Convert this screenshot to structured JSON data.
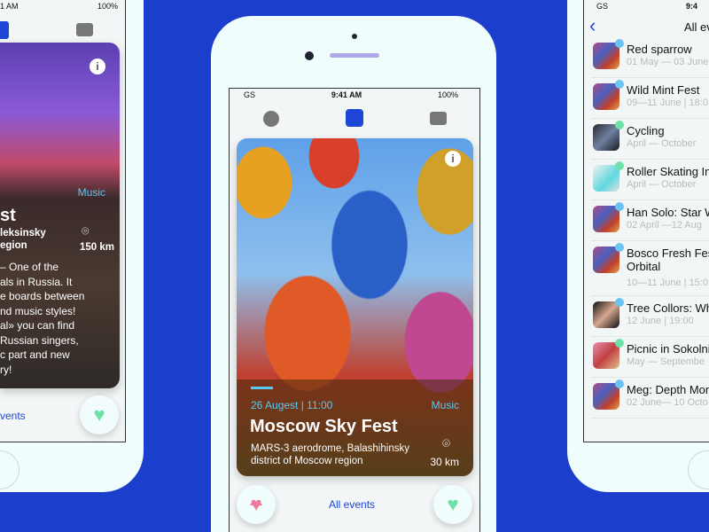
{
  "colors": {
    "background": "#1b3fcc",
    "accent": "#1d45d6",
    "highlight": "#5bc8f0",
    "like": "#6ee0a8",
    "dislike": "#f07a9a"
  },
  "left_phone": {
    "status": {
      "time": "1 AM",
      "battery": "100%"
    },
    "card": {
      "category": "Music",
      "title": "st",
      "location": "leksinsky\negion",
      "distance": "150 km",
      "description": [
        "– One of the",
        "als in Russia. It",
        "e boards between",
        "nd music styles!",
        "al» you can find",
        "Russian singers,",
        "c part and new",
        "ry!"
      ]
    },
    "all_events": "vents"
  },
  "center_phone": {
    "status": {
      "carrier": "GS",
      "time": "9:41 AM",
      "battery": "100%"
    },
    "nav": {
      "icons": [
        "profile-icon",
        "events-grid-icon",
        "chat-icon"
      ]
    },
    "card": {
      "date": "26 Augest | 11:00",
      "category": "Music",
      "title": "Moscow Sky Fest",
      "location_line1": "MARS-3 aerodrome, Balashihinsky",
      "location_line2": "district of Moscow region",
      "distance": "30 km"
    },
    "all_events": "All events"
  },
  "right_phone": {
    "status": {
      "carrier": "GS",
      "time": "9:4"
    },
    "title": "All eve",
    "items": [
      {
        "title": "Red sparrow",
        "sub": "01 May — 03 June",
        "dot": "#6cc4f2",
        "thumb": "crowd"
      },
      {
        "title": "Wild Mint Fest",
        "sub": "09—11 June | 18:0",
        "dot": "#6cc4f2",
        "thumb": "crowd"
      },
      {
        "title": "Cycling",
        "sub": "April — October",
        "dot": "#6ee0a8",
        "thumb": "cycling"
      },
      {
        "title": "Roller Skating In",
        "sub": "April — October",
        "dot": "#6ee0a8",
        "thumb": "skate"
      },
      {
        "title": "Han Solo: Star W",
        "sub": "02 April —12 Aug",
        "dot": "#6cc4f2",
        "thumb": "crowd"
      },
      {
        "title": "Bosco Fresh Fes",
        "title2": "Orbital",
        "sub": "10—11 June | 15:0",
        "dot": "#6cc4f2",
        "thumb": "crowd"
      },
      {
        "title": "Tree Collors: Wh",
        "sub": "12 June | 19:00",
        "dot": "#6cc4f2",
        "thumb": "portrait"
      },
      {
        "title": "Picnic in Sokolni",
        "sub": "May — Septembe",
        "dot": "#6ee0a8",
        "thumb": "food"
      },
      {
        "title": "Meg: Depth Mon",
        "sub": "02 June— 10 Octo",
        "dot": "#6cc4f2",
        "thumb": "crowd"
      }
    ]
  }
}
